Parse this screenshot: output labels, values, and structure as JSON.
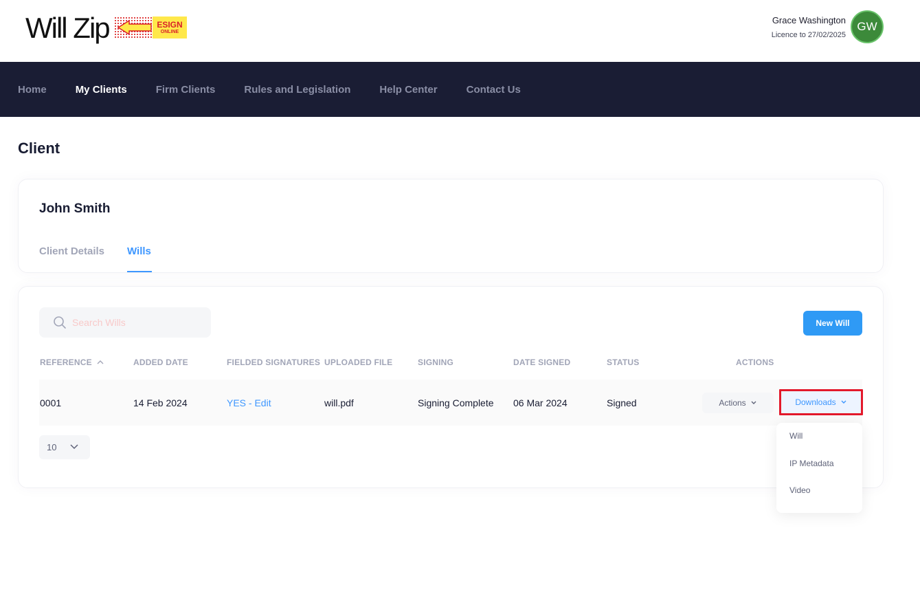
{
  "header": {
    "logo_text": "Will Zip",
    "logo_badge_main": "ESIGN",
    "logo_badge_sub": "ONLINE",
    "user_name": "Grace Washington",
    "licence": "Licence to 27/02/2025",
    "avatar_initials": "GW"
  },
  "nav": {
    "items": [
      "Home",
      "My Clients",
      "Firm Clients",
      "Rules and Legislation",
      "Help Center",
      "Contact Us"
    ]
  },
  "page": {
    "title": "Client"
  },
  "client": {
    "name": "John Smith",
    "tabs": [
      "Client Details",
      "Wills"
    ]
  },
  "wills": {
    "search_placeholder": "Search Wills",
    "new_button": "New Will",
    "columns": [
      "REFERENCE",
      "ADDED DATE",
      "FIELDED SIGNATURES",
      "UPLOADED FILE",
      "SIGNING",
      "DATE SIGNED",
      "STATUS",
      "ACTIONS"
    ],
    "row": {
      "reference": "0001",
      "added_date": "14 Feb 2024",
      "fielded_signatures": "YES - Edit",
      "uploaded_file": "will.pdf",
      "signing": "Signing Complete",
      "date_signed": "06 Mar 2024",
      "status": "Signed",
      "actions_label": "Actions",
      "downloads_label": "Downloads"
    },
    "page_size": "10",
    "downloads_menu": [
      "Will",
      "IP Metadata",
      "Video"
    ]
  },
  "colors": {
    "nav_bg": "#1a1d34",
    "primary": "#3e97ff",
    "button": "#2f9af5",
    "avatar": "#3c8a3a",
    "highlight_border": "#e3192b"
  }
}
